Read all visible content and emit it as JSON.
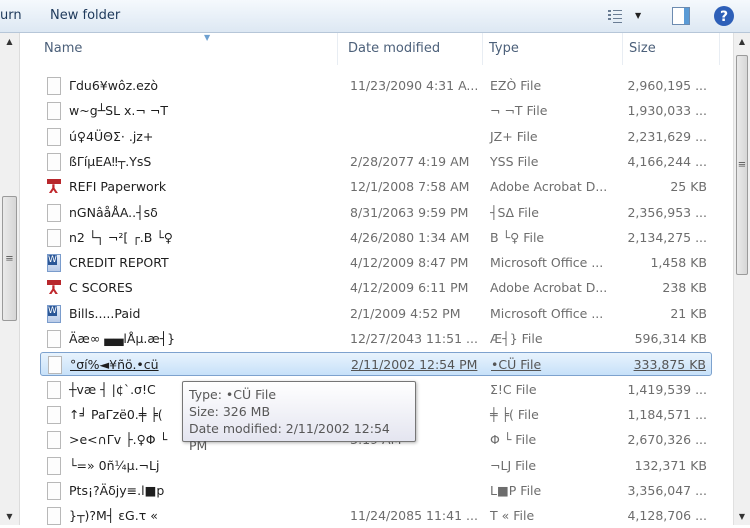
{
  "toolbar": {
    "partial_left": "urn",
    "new_folder": "New folder",
    "icons": [
      "views-icon",
      "dropdown-icon",
      "preview-pane-icon",
      "help-icon"
    ]
  },
  "columns": {
    "name": "Name",
    "date": "Date modified",
    "type": "Type",
    "size": "Size"
  },
  "files": [
    {
      "name": "Γdu6¥wôz.ezò",
      "date": "11/23/2090 4:31 A...",
      "type": "EZÒ File",
      "size": "2,960,195 ...",
      "icon": "generic"
    },
    {
      "name": "w~g┴SL x.¬  ¬T",
      "date": "",
      "type": "¬  ¬T File",
      "size": "1,930,033 ...",
      "icon": "generic"
    },
    {
      "name": "ú♀4ÜΘΣ· .jz+",
      "date": "",
      "type": "JZ+ File",
      "size": "2,231,629 ...",
      "icon": "generic"
    },
    {
      "name": "ßΓíµEA‼┬.YsS",
      "date": "2/28/2077 4:19 AM",
      "type": "YSS File",
      "size": "4,166,244 ...",
      "icon": "generic"
    },
    {
      "name": "REFI Paperwork",
      "date": "12/1/2008 7:58 AM",
      "type": "Adobe Acrobat D...",
      "size": "25 KB",
      "icon": "pdf"
    },
    {
      "name": "nGNâåÅA..┤sδ",
      "date": "8/31/2063 9:59 PM",
      "type": "┤SΔ File",
      "size": "2,356,953 ...",
      "icon": "generic"
    },
    {
      "name": "n2 └┐ ¬²[ ┌.B └♀",
      "date": "4/26/2080 1:34 AM",
      "type": "B └♀ File",
      "size": "2,134,275 ...",
      "icon": "generic"
    },
    {
      "name": "CREDIT REPORT",
      "date": "4/12/2009 8:47 PM",
      "type": "Microsoft Office ...",
      "size": "1,458 KB",
      "icon": "doc"
    },
    {
      "name": "C SCORES",
      "date": "4/12/2009 6:11 PM",
      "type": "Adobe Acrobat D...",
      "size": "238 KB",
      "icon": "pdf"
    },
    {
      "name": "Bills.....Paid",
      "date": "2/1/2009 4:52 PM",
      "type": "Microsoft Office ...",
      "size": "21 KB",
      "icon": "doc"
    },
    {
      "name": "Äæ∞ ▄▄lÅµ.æ┤}",
      "date": "12/27/2043 11:51 ...",
      "type": "Æ┤} File",
      "size": "596,314 KB",
      "icon": "generic"
    },
    {
      "name": "°σí%◄¥ñö.•cü",
      "date": "2/11/2002 12:54 PM",
      "type": "•CÜ File",
      "size": "333,875 KB",
      "icon": "generic"
    },
    {
      "name": "┼væ ┤ |¢`.σ!C",
      "date": "",
      "type": "Σ!C File",
      "size": "1,419,539 ...",
      "icon": "generic"
    },
    {
      "name": "↑╛ PaΓzë0.╪ ╞(",
      "date": "",
      "type": "╪ ╞( File",
      "size": "1,184,571 ...",
      "icon": "generic"
    },
    {
      "name": ">e<∩Γv ├.♀Φ └",
      "date": "3:19 AM",
      "type": "Φ └ File",
      "size": "2,670,326 ...",
      "icon": "generic"
    },
    {
      "name": "└=»   0ñ¼µ.¬Lj",
      "date": "",
      "type": "¬LJ File",
      "size": "132,371 KB",
      "icon": "generic"
    },
    {
      "name": "Pts¡?Äδjy≡.l■p",
      "date": "",
      "type": "L■P File",
      "size": "3,356,047 ...",
      "icon": "generic"
    },
    {
      "name": "}┬)?M┤ εG.τ «",
      "date": "11/24/2085 11:41 ...",
      "type": "T « File",
      "size": "4,128,706 ...",
      "icon": "generic"
    }
  ],
  "selected_index": 11,
  "tooltip": {
    "type": "Type: •CÜ File",
    "size": "Size: 326 MB",
    "date": "Date modified: 2/11/2002 12:54 PM"
  }
}
